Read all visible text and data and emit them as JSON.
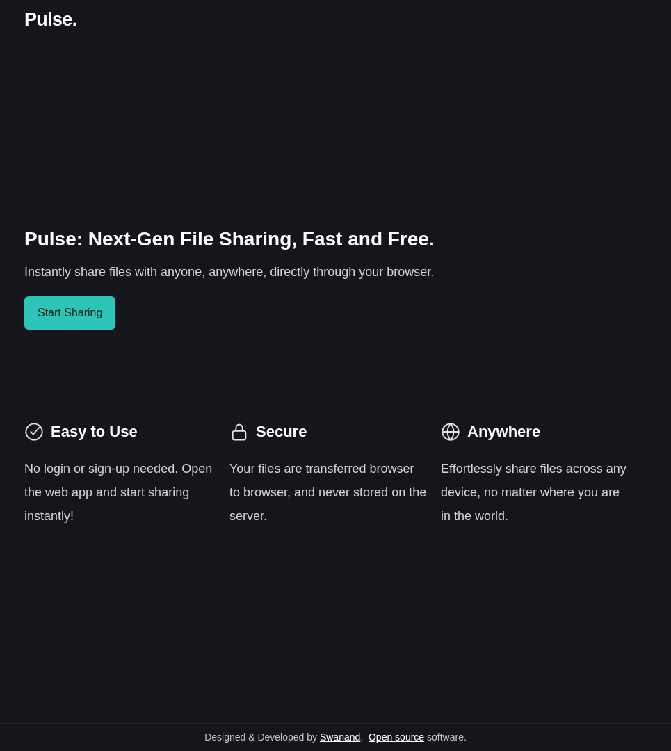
{
  "header": {
    "logo": "Pulse."
  },
  "hero": {
    "title": "Pulse: Next-Gen File Sharing, Fast and Free.",
    "subtitle": "Instantly share files with anyone, anywhere, directly through your browser.",
    "button": "Start Sharing"
  },
  "features": [
    {
      "kind": "check",
      "title": "Easy to Use",
      "text": "No login or sign-up needed. Open the web app and start sharing instantly!"
    },
    {
      "kind": "lock",
      "title": "Secure",
      "text": "Your files are transferred browser to browser, and never stored on the server."
    },
    {
      "kind": "globe",
      "title": "Anywhere",
      "text": "Effortlessly share files across any device, no matter where you are in the world."
    }
  ],
  "footer": {
    "parts": [
      {
        "kind": "text",
        "text": "Designed & Developed by "
      },
      {
        "kind": "link",
        "text": "Swanand"
      },
      {
        "kind": "text",
        "text": ".  "
      },
      {
        "kind": "link",
        "text": "Open source"
      },
      {
        "kind": "text",
        "text": " software."
      }
    ]
  }
}
